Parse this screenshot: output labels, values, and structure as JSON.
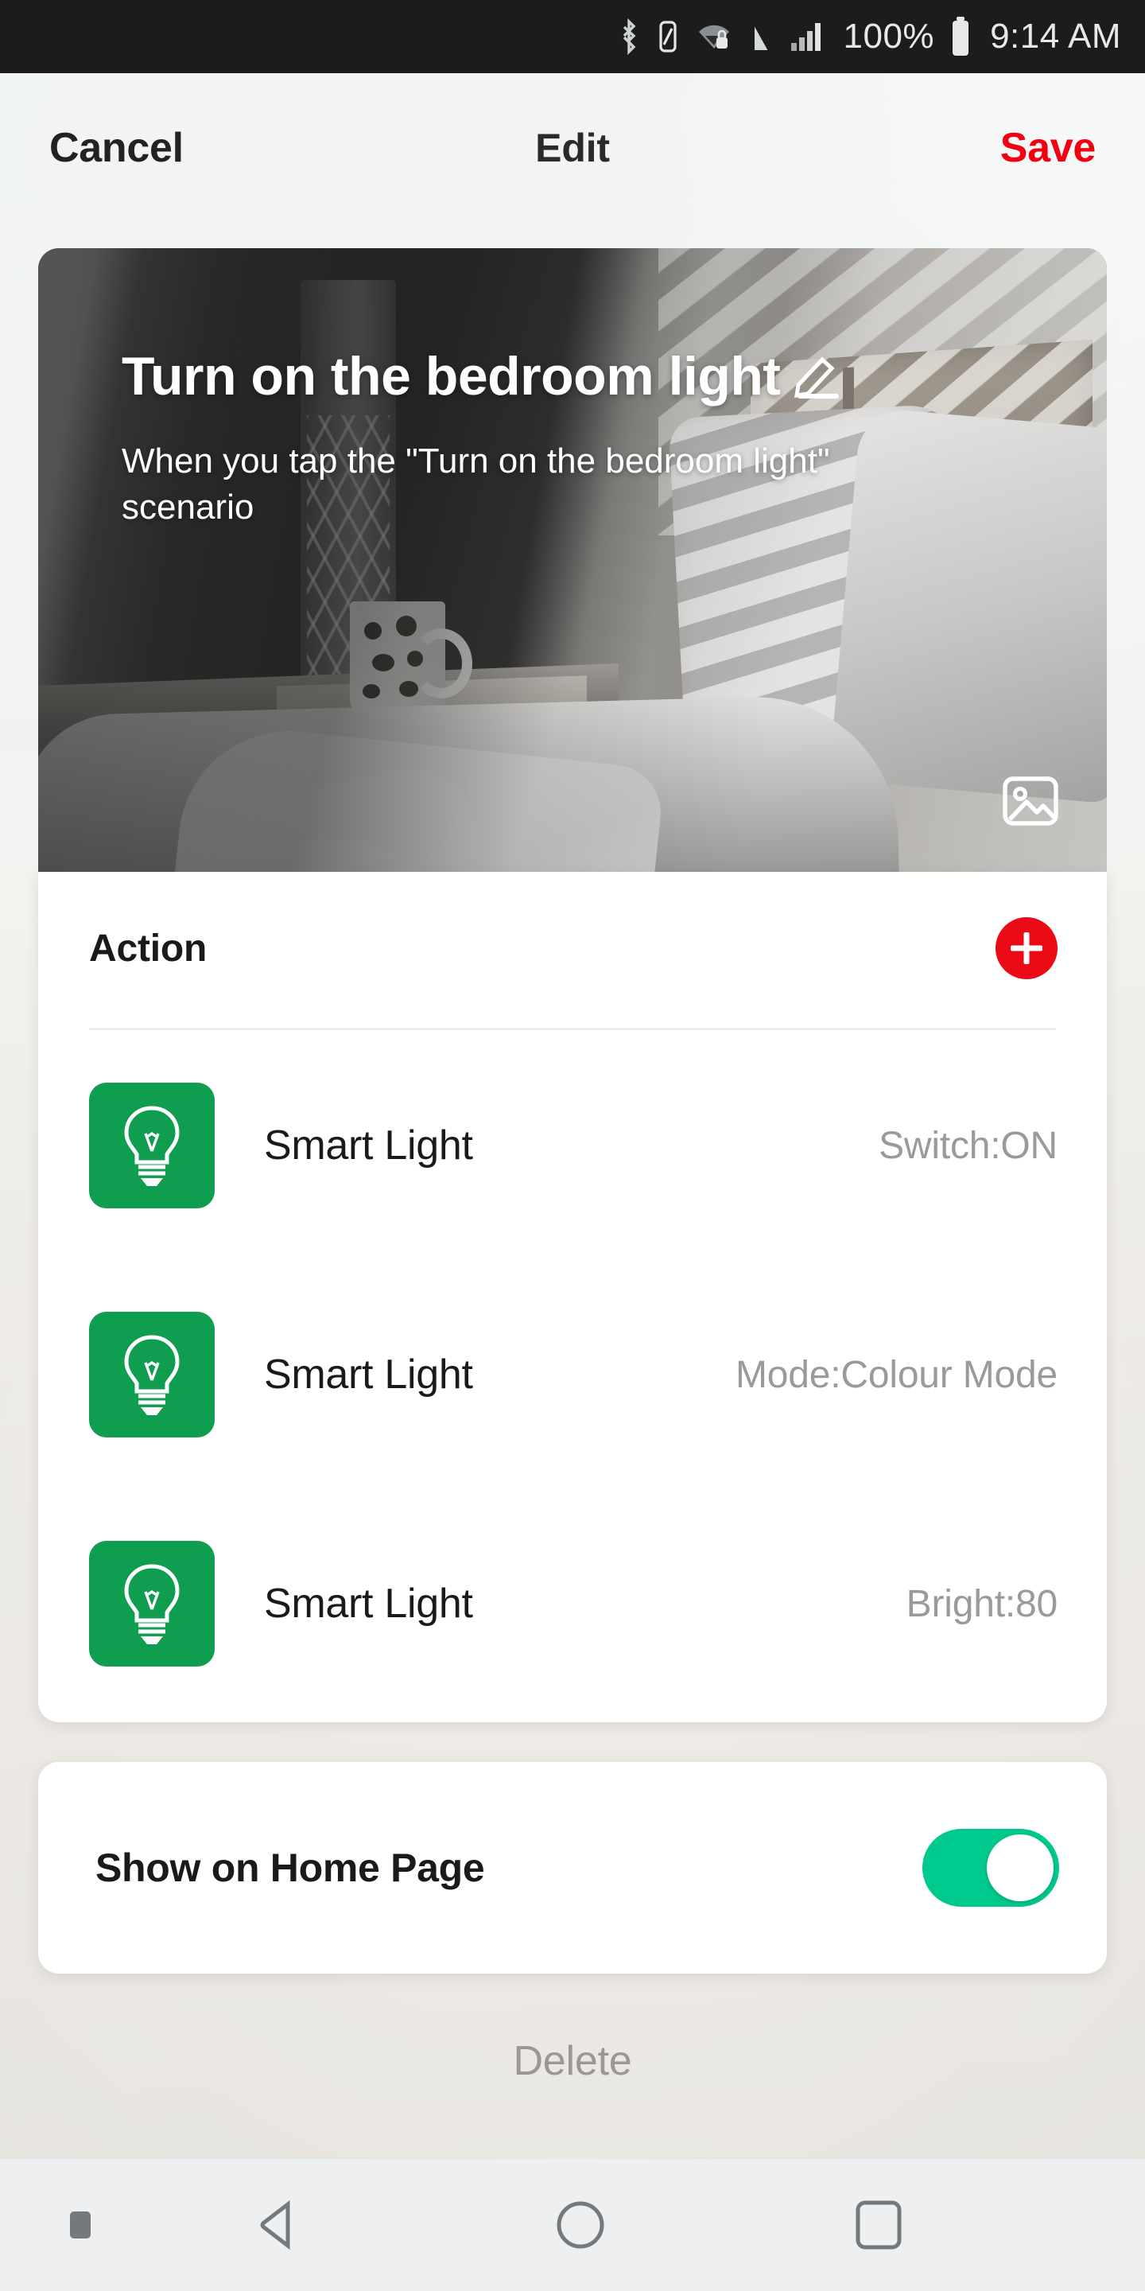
{
  "status_bar": {
    "icons": [
      "bluetooth-icon",
      "nfc-icon",
      "wifi-lock-icon",
      "vpn-icon",
      "signal-icon"
    ],
    "battery_percent": "100%",
    "battery_icon": "battery-full-icon",
    "clock": "9:14 AM"
  },
  "app_bar": {
    "cancel_label": "Cancel",
    "title": "Edit",
    "save_label": "Save"
  },
  "hero": {
    "title": "Turn on the bedroom light",
    "edit_icon": "pencil-icon",
    "subtitle": "When you tap the \"Turn on the bedroom light\" scenario",
    "image_picker_icon": "image-icon",
    "photo_description": "bedroom with bed, pillows, nightstand, mug and lamp"
  },
  "action_section": {
    "title": "Action",
    "add_button_label": "+",
    "add_button_color": "#ea0a16",
    "rows": [
      {
        "icon": "light-bulb-icon",
        "icon_color": "#0f9d4f",
        "name": "Smart Light",
        "value": "Switch:ON"
      },
      {
        "icon": "light-bulb-icon",
        "icon_color": "#0f9d4f",
        "name": "Smart Light",
        "value": "Mode:Colour Mode"
      },
      {
        "icon": "light-bulb-icon",
        "icon_color": "#0f9d4f",
        "name": "Smart Light",
        "value": "Bright:80"
      }
    ]
  },
  "home_page_section": {
    "label": "Show on Home Page",
    "toggle_state": "on",
    "toggle_color": "#00c98e"
  },
  "delete": {
    "label": "Delete"
  },
  "nav_bar": {
    "pin_icon": "nav-pin-icon",
    "back_icon": "back-triangle-icon",
    "home_icon": "home-circle-icon",
    "recents_icon": "recents-square-icon"
  },
  "colors": {
    "accent_red": "#f2000f",
    "accent_green": "#0f9d4f",
    "toggle_green": "#00c98e",
    "card_bg": "#ffffff",
    "page_bg": "#eceae5",
    "status_bar_bg": "#1c1c1c"
  }
}
